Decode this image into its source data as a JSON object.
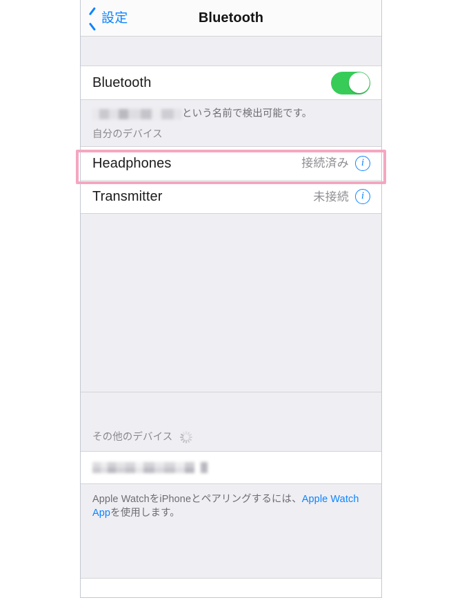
{
  "navbar": {
    "back_label": "設定",
    "title": "Bluetooth",
    "back_icon": "chevron-left-icon"
  },
  "bluetooth_row": {
    "label": "Bluetooth",
    "toggle_state": "on",
    "toggle_color": "#37cc58"
  },
  "discoverable_caption": {
    "redacted_name": "",
    "text": "という名前で検出可能です。"
  },
  "my_devices": {
    "header": "自分のデバイス",
    "items": [
      {
        "name": "Headphones",
        "status": "接続済み",
        "info_icon": "info-circle-icon",
        "highlighted": true
      },
      {
        "name": "Transmitter",
        "status": "未接続",
        "info_icon": "info-circle-icon",
        "highlighted": false
      }
    ]
  },
  "other_devices": {
    "header": "その他のデバイス",
    "spinner_icon": "activity-spinner-icon",
    "items": [
      {
        "redacted_name": ""
      }
    ]
  },
  "footer": {
    "text_before_link": "Apple WatchをiPhoneとペアリングするには、",
    "link_label": "Apple Watch App",
    "text_after_link": "を使用します。",
    "link_color": "#0a84ff"
  },
  "annotation": {
    "highlight_color": "#f5a6c0",
    "target": "Headphones"
  }
}
